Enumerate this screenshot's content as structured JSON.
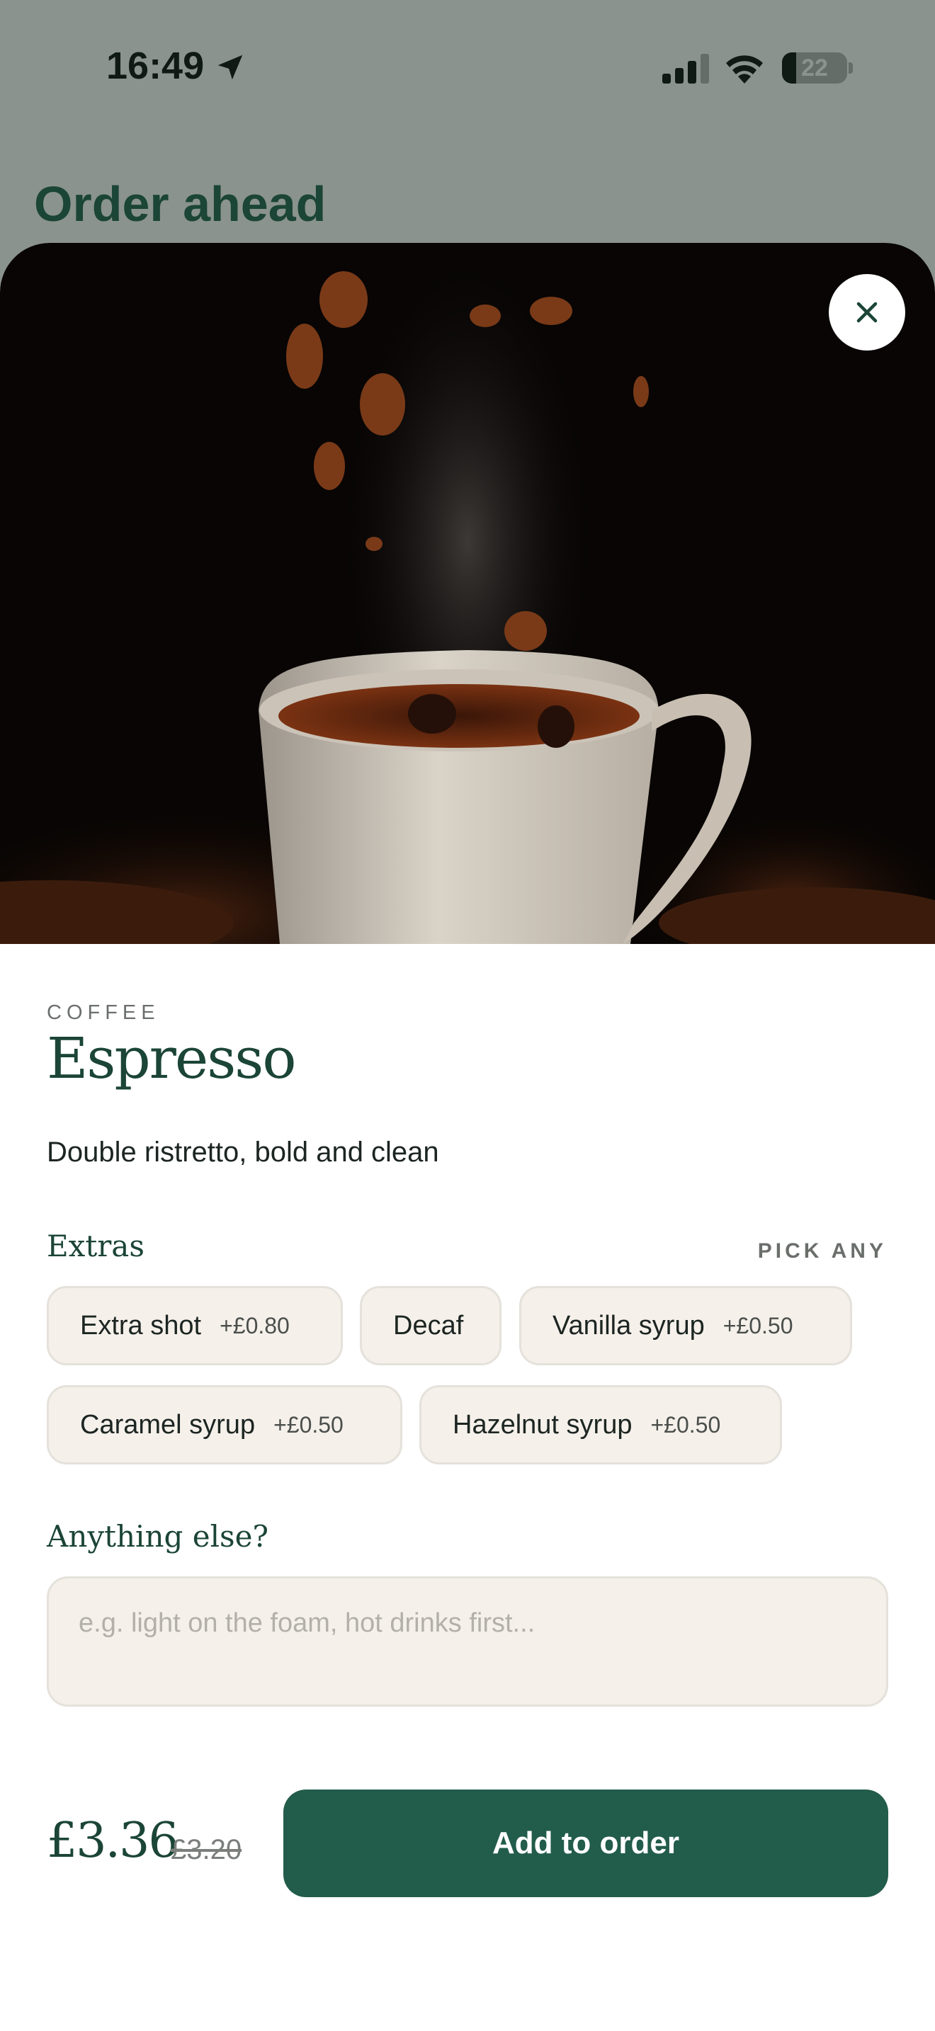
{
  "status_bar": {
    "time": "16:49",
    "battery": "22",
    "battery_level": 0.22
  },
  "header": {
    "title": "Order ahead"
  },
  "product": {
    "category": "COFFEE",
    "name": "Espresso",
    "description": "Double ristretto, bold and clean",
    "image_icon": "coffee-cup-photo"
  },
  "extras": {
    "title": "Extras",
    "hint": "PICK ANY",
    "options": [
      {
        "name": "Extra shot",
        "price": "+£0.80"
      },
      {
        "name": "Decaf",
        "price": ""
      },
      {
        "name": "Vanilla syrup",
        "price": "+£0.50"
      },
      {
        "name": "Caramel syrup",
        "price": "+£0.50"
      },
      {
        "name": "Hazelnut syrup",
        "price": "+£0.50"
      }
    ]
  },
  "notes": {
    "title": "Anything else?",
    "placeholder": "e.g. light on the foam, hot drinks first...",
    "value": ""
  },
  "footer": {
    "price": "£3.36",
    "old_price": "£3.20",
    "add_button": "Add to order"
  },
  "colors": {
    "brand": "#225c4a",
    "title": "#1b4536",
    "chip_bg": "#f5f0ea",
    "backdrop": "#8a938e"
  }
}
